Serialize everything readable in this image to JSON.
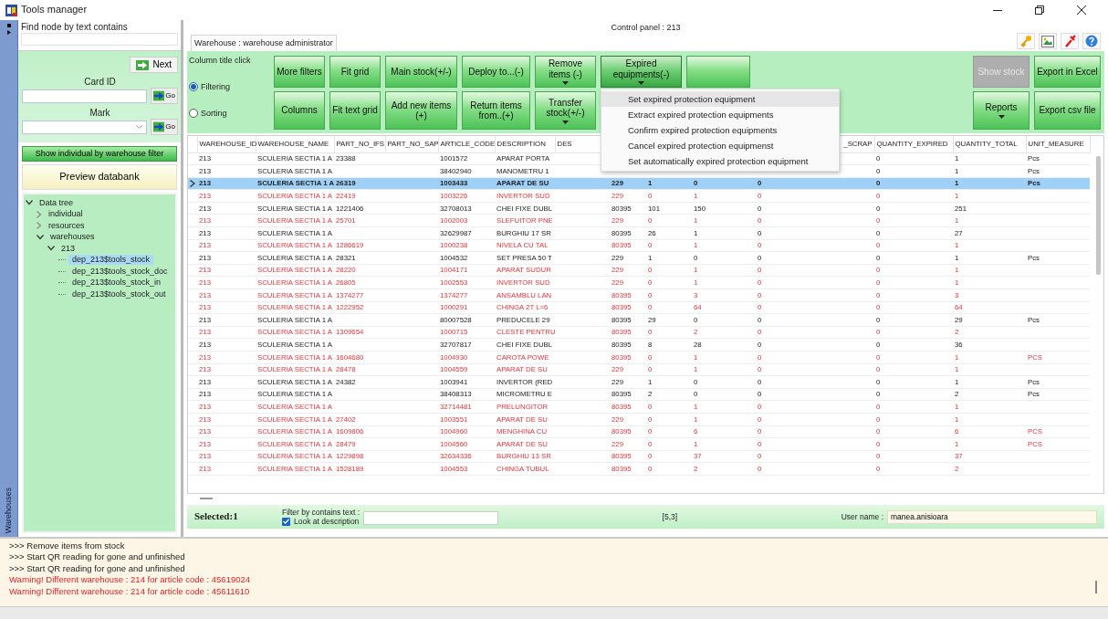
{
  "window": {
    "title": "Tools manager"
  },
  "side_strip": {
    "label": "Warehouses"
  },
  "left_panel": {
    "find_label": "Find node by text contains",
    "next_button": "Next",
    "card_id": {
      "label": "Card ID",
      "go": "Go"
    },
    "mark": {
      "label": "Mark",
      "go": "Go"
    },
    "filter_button": "Show individual by warehouse filter",
    "preview_button": "Preview databank",
    "tree": [
      {
        "label": "Data tree",
        "expanded": true,
        "selected": false,
        "children": [
          {
            "label": "individual",
            "expanded": false,
            "selected": false
          },
          {
            "label": "resources",
            "expanded": false,
            "selected": false
          },
          {
            "label": "warehouses",
            "expanded": true,
            "selected": false,
            "children": [
              {
                "label": "213",
                "expanded": true,
                "selected": false,
                "children": [
                  {
                    "label": "dep_213$tools_stock",
                    "selected": true
                  },
                  {
                    "label": "dep_213$tools_stock_doc",
                    "selected": false
                  },
                  {
                    "label": "dep_213$tools_stock_in",
                    "selected": false
                  },
                  {
                    "label": "dep_213$tools_stock_out",
                    "selected": false
                  }
                ]
              }
            ]
          }
        ]
      }
    ]
  },
  "header": {
    "title": "Control panel : 213",
    "tab": "Warehouse : warehouse administrator"
  },
  "toolbar": {
    "group_label": "Column title click",
    "modes": [
      {
        "label": "Filtering",
        "selected": true
      },
      {
        "label": "Sorting",
        "selected": false
      }
    ],
    "rows": [
      [
        {
          "label": "More filters",
          "dropdown": false,
          "disabled": false,
          "expanded": false
        },
        {
          "label": "Fit  grid",
          "dropdown": false,
          "disabled": false,
          "expanded": false
        },
        {
          "label": "Main stock(+/-)",
          "dropdown": false,
          "disabled": false,
          "expanded": false
        },
        {
          "label": "Deploy to...(-)",
          "dropdown": false,
          "disabled": false,
          "expanded": false
        },
        {
          "label": "Remove items (-)",
          "dropdown": true,
          "disabled": false,
          "expanded": false
        },
        {
          "label": "Expired equipments(-)",
          "dropdown": true,
          "disabled": false,
          "expanded": true
        },
        {
          "dropdown": false,
          "disabled": false,
          "expanded": false
        }
      ],
      [
        {
          "label": "Columns",
          "dropdown": false,
          "disabled": false,
          "expanded": false
        },
        {
          "label": "Fit text grid",
          "dropdown": false,
          "disabled": false,
          "expanded": false
        },
        {
          "label": "Add new items (+)",
          "dropdown": false,
          "disabled": false,
          "expanded": false
        },
        {
          "label": "Return items from..(+)",
          "dropdown": false,
          "disabled": false,
          "expanded": false
        },
        {
          "label": "Transfer stock(+/-)",
          "dropdown": true,
          "disabled": false,
          "expanded": false
        }
      ]
    ],
    "right_rows": [
      [
        {
          "label": "Show stock",
          "dropdown": false,
          "disabled": true
        },
        {
          "label": "Export in Excel",
          "dropdown": false,
          "disabled": false
        }
      ],
      [
        {
          "label": "Reports",
          "dropdown": true,
          "disabled": false
        },
        {
          "label": "Export csv file",
          "dropdown": false,
          "disabled": false
        }
      ]
    ]
  },
  "menu": {
    "items": [
      {
        "label": "Set expired protection equipment",
        "selected": true
      },
      {
        "label": "Extract expired protection equipments",
        "selected": false
      },
      {
        "label": "Confirm expired protection equipments",
        "selected": false
      },
      {
        "label": "Cancel expired protection equipmenst",
        "selected": false
      },
      {
        "label": "Set automatically expired protection equipment",
        "selected": false
      }
    ]
  },
  "table": {
    "columns": [
      "WAREHOUSE_ID",
      "WAREHOUSE_NAME",
      "PART_NO_IFS",
      "PART_NO_SAP",
      "ARTICLE_CODE",
      "DESCRIPTION",
      "DES",
      null,
      null,
      null,
      "_SCRAP",
      "QUANTITY_EXPIRED",
      "QUANTITY_TOTAL",
      "UNIT_MEASURE"
    ],
    "rows": [
      {
        "selected": false,
        "alert": false,
        "cells": [
          "213",
          "SCULERIA SECTIA 1 A",
          "23388",
          null,
          "1001572",
          "APARAT PORTA",
          null,
          null,
          null,
          null,
          null,
          "0",
          "1",
          "Pcs"
        ]
      },
      {
        "selected": false,
        "alert": false,
        "cells": [
          "213",
          "SCULERIA SECTIA 1 A",
          null,
          null,
          "38402940",
          "MANOMETRU 1",
          null,
          null,
          null,
          null,
          null,
          "0",
          "1",
          "Pcs"
        ]
      },
      {
        "selected": true,
        "alert": false,
        "cells": [
          "213",
          "SCULERIA SECTIA 1 A",
          "26319",
          null,
          "1003433",
          "APARAT DE SU",
          null,
          "229",
          "1",
          "0",
          "0",
          "0",
          "1",
          "Pcs"
        ]
      },
      {
        "selected": false,
        "alert": true,
        "cells": [
          "213",
          "SCULERIA SECTIA 1 A",
          "22419",
          null,
          "1003226",
          "INVERTOR SUD",
          null,
          "229",
          "0",
          "1",
          "0",
          "0",
          "1",
          null
        ]
      },
      {
        "selected": false,
        "alert": false,
        "cells": [
          "213",
          "SCULERIA SECTIA 1 A",
          "1221406",
          null,
          "32708013",
          "CHEI FIXE DUBL",
          null,
          "80395",
          "101",
          "150",
          "0",
          "0",
          "251",
          null
        ]
      },
      {
        "selected": false,
        "alert": true,
        "cells": [
          "213",
          "SCULERIA SECTIA 1 A",
          "25701",
          null,
          "1002003",
          "SLEFUITOR PNE",
          null,
          "229",
          "0",
          "1",
          "0",
          "0",
          "1",
          null
        ]
      },
      {
        "selected": false,
        "alert": false,
        "cells": [
          "213",
          "SCULERIA SECTIA 1 A",
          null,
          null,
          "32629987",
          "BURGHIU 17 SR",
          null,
          "80395",
          "26",
          "1",
          "0",
          "0",
          "27",
          null
        ]
      },
      {
        "selected": false,
        "alert": true,
        "cells": [
          "213",
          "SCULERIA SECTIA 1 A",
          "1286619",
          null,
          "1000238",
          "NIVELA CU TAL",
          null,
          "80395",
          "0",
          "1",
          "0",
          "0",
          "1",
          null
        ]
      },
      {
        "selected": false,
        "alert": false,
        "cells": [
          "213",
          "SCULERIA SECTIA 1 A",
          "28321",
          null,
          "1004532",
          "SET PRESA 50 T",
          null,
          "229",
          "1",
          "0",
          "0",
          "0",
          "1",
          "Pcs"
        ]
      },
      {
        "selected": false,
        "alert": true,
        "cells": [
          "213",
          "SCULERIA SECTIA 1 A",
          "28220",
          null,
          "1004171",
          "APARAT SUDUR",
          null,
          "229",
          "0",
          "1",
          "0",
          "0",
          "1",
          null
        ]
      },
      {
        "selected": false,
        "alert": true,
        "cells": [
          "213",
          "SCULERIA SECTIA 1 A",
          "26805",
          null,
          "1002553",
          "INVERTOR SUD",
          null,
          "229",
          "0",
          "1",
          "0",
          "0",
          "1",
          null
        ]
      },
      {
        "selected": false,
        "alert": true,
        "cells": [
          "213",
          "SCULERIA SECTIA 1 A",
          "1374277",
          null,
          "1374277",
          "ANSAMBLU LAN",
          null,
          "80395",
          "0",
          "3",
          "0",
          "0",
          "3",
          null
        ]
      },
      {
        "selected": false,
        "alert": true,
        "cells": [
          "213",
          "SCULERIA SECTIA 1 A",
          "1222952",
          null,
          "1000291",
          "CHINGA 2T L=6",
          null,
          "80395",
          "0",
          "64",
          "0",
          "0",
          "64",
          null
        ]
      },
      {
        "selected": false,
        "alert": false,
        "cells": [
          "213",
          "SCULERIA SECTIA 1 A",
          null,
          null,
          "80007528",
          "PREDUCELE 29",
          null,
          "80395",
          "29",
          "0",
          "0",
          "0",
          "29",
          "Pcs"
        ]
      },
      {
        "selected": false,
        "alert": true,
        "cells": [
          "213",
          "SCULERIA SECTIA 1 A",
          "1309654",
          null,
          "1000715",
          "CLESTE PENTRU",
          null,
          "80395",
          "0",
          "2",
          "0",
          "0",
          "2",
          null
        ]
      },
      {
        "selected": false,
        "alert": false,
        "cells": [
          "213",
          "SCULERIA SECTIA 1 A",
          null,
          null,
          "32707817",
          "CHEI FIXE DUBL",
          null,
          "80395",
          "8",
          "28",
          "0",
          "0",
          "36",
          null
        ]
      },
      {
        "selected": false,
        "alert": true,
        "cells": [
          "213",
          "SCULERIA SECTIA 1 A",
          "1604680",
          null,
          "1004930",
          "CAROTA POWE",
          null,
          "80395",
          "0",
          "1",
          "0",
          "0",
          "1",
          "PCS"
        ]
      },
      {
        "selected": false,
        "alert": true,
        "cells": [
          "213",
          "SCULERIA SECTIA 1 A",
          "28478",
          null,
          "1004559",
          "APARAT DE SU",
          null,
          "229",
          "0",
          "1",
          "0",
          "0",
          "1",
          null
        ]
      },
      {
        "selected": false,
        "alert": false,
        "cells": [
          "213",
          "SCULERIA SECTIA 1 A",
          "24382",
          null,
          "1003941",
          "INVERTOR (RED",
          null,
          "229",
          "1",
          "0",
          "0",
          "0",
          "1",
          "Pcs"
        ]
      },
      {
        "selected": false,
        "alert": false,
        "cells": [
          "213",
          "SCULERIA SECTIA 1 A",
          null,
          null,
          "38408313",
          "MICROMETRU E",
          null,
          "80395",
          "2",
          "0",
          "0",
          "0",
          "2",
          "Pcs"
        ]
      },
      {
        "selected": false,
        "alert": true,
        "cells": [
          "213",
          "SCULERIA SECTIA 1 A",
          null,
          null,
          "32714481",
          "PRELUNGITOR",
          null,
          "80395",
          "0",
          "1",
          "0",
          "0",
          "1",
          null
        ]
      },
      {
        "selected": false,
        "alert": true,
        "cells": [
          "213",
          "SCULERIA SECTIA 1 A",
          "27402",
          null,
          "1003551",
          "APARAT DE SU",
          null,
          "229",
          "0",
          "1",
          "0",
          "0",
          "1",
          null
        ]
      },
      {
        "selected": false,
        "alert": true,
        "cells": [
          "213",
          "SCULERIA SECTIA 1 A",
          "1609806",
          null,
          "1004960",
          "MENGHINA CU",
          null,
          "80395",
          "0",
          "6",
          "0",
          "0",
          "6",
          "PCS"
        ]
      },
      {
        "selected": false,
        "alert": true,
        "cells": [
          "213",
          "SCULERIA SECTIA 1 A",
          "28479",
          null,
          "1004560",
          "APARAT DE SU",
          null,
          "229",
          "0",
          "1",
          "0",
          "0",
          "1",
          "PCS"
        ]
      },
      {
        "selected": false,
        "alert": true,
        "cells": [
          "213",
          "SCULERIA SECTIA 1 A",
          "1229898",
          null,
          "32634336",
          "BURGHIU 13 SR",
          null,
          "80395",
          "0",
          "37",
          "0",
          "0",
          "37",
          null
        ]
      },
      {
        "selected": false,
        "alert": true,
        "cells": [
          "213",
          "SCULERIA SECTIA 1 A",
          "1528189",
          null,
          "1004553",
          "CHINGA TUBUL",
          null,
          "80395",
          "0",
          "2",
          "0",
          "0",
          "2",
          null
        ]
      }
    ]
  },
  "footer": {
    "selected": "Selected:1",
    "filter_label": "Filter by contains text :",
    "look": {
      "label": "Look at description",
      "checked": true
    },
    "position": "[5,3]",
    "user_label": "User name :",
    "user": "manea.anisioara"
  },
  "log": [
    {
      "text": ">>> Remove items from stock",
      "warning": false
    },
    {
      "text": ">>> Start QR reading for gone and unfinished",
      "warning": false
    },
    {
      "text": ">>> Start QR reading for gone and unfinished",
      "warning": false
    },
    {
      "text": "Warning! Different warehouse : 214 for article code : 45619024",
      "warning": true
    },
    {
      "text": "Warning! Different warehouse : 214 for article code : 45611610",
      "warning": true
    }
  ]
}
